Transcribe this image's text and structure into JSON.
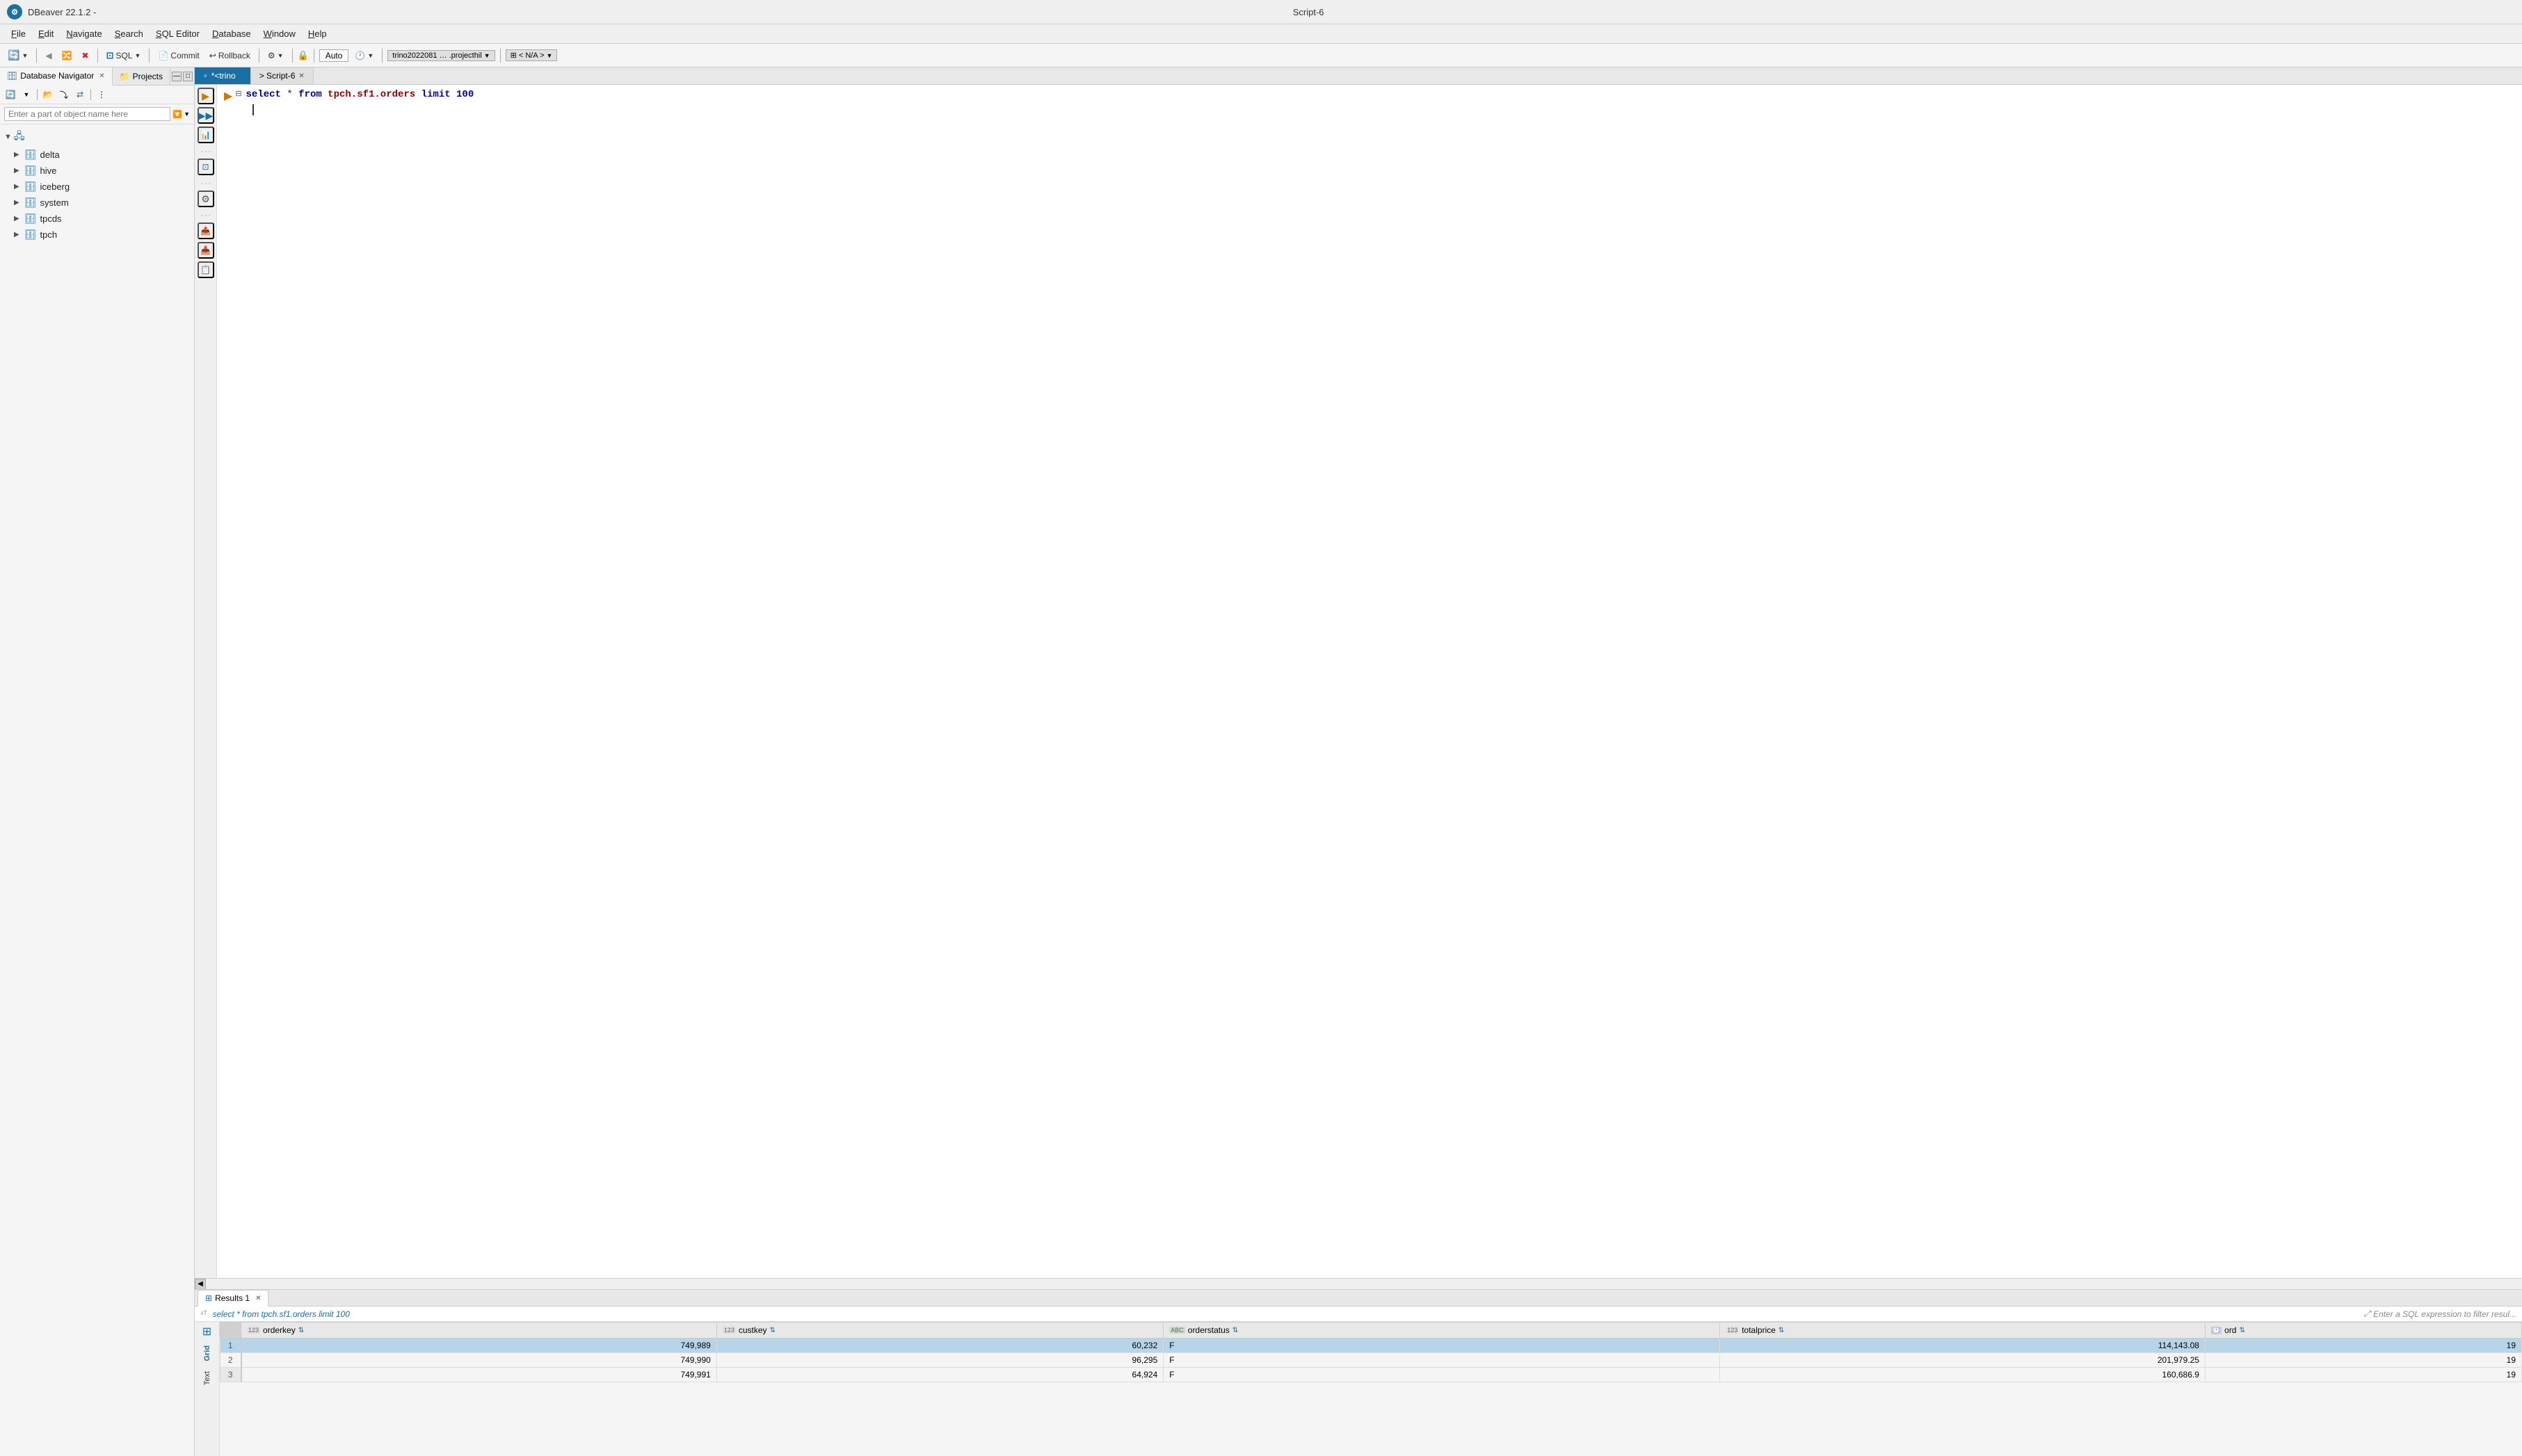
{
  "window": {
    "title": "DBeaver 22.1.2 -",
    "center_title": "Script-6",
    "logo_text": "DB"
  },
  "menu": {
    "items": [
      "File",
      "Edit",
      "Navigate",
      "Search",
      "SQL Editor",
      "Database",
      "Window",
      "Help"
    ]
  },
  "toolbar": {
    "sql_label": "SQL",
    "commit_label": "Commit",
    "rollback_label": "Rollback",
    "auto_label": "Auto",
    "connection_label": "trino2022081 … .projecthil",
    "schema_label": "< N/A >"
  },
  "left_panel": {
    "tab1_label": "Database Navigator",
    "tab2_label": "Projects",
    "search_placeholder": "Enter a part of object name here",
    "tree_items": [
      {
        "label": "delta",
        "type": "db"
      },
      {
        "label": "hive",
        "type": "db"
      },
      {
        "label": "iceberg",
        "type": "db"
      },
      {
        "label": "system",
        "type": "db"
      },
      {
        "label": "tpcds",
        "type": "db"
      },
      {
        "label": "tpch",
        "type": "db"
      }
    ]
  },
  "editor": {
    "tab1_label": "*<trino",
    "tab2_label": "> Script-6",
    "query": "select * from tpch.sf1.orders limit 100"
  },
  "results": {
    "tab_label": "Results 1",
    "filter_query": "select * from tpch.sf1.orders limit 100",
    "filter_placeholder": "Enter a SQL expression to filter resul...",
    "columns": [
      {
        "type": "123",
        "label": "orderkey",
        "type_label": "123"
      },
      {
        "type": "123",
        "label": "custkey",
        "type_label": "123"
      },
      {
        "type": "ABC",
        "label": "orderstatus",
        "type_label": "abc"
      },
      {
        "type": "123",
        "label": "totalprice",
        "type_label": "123"
      },
      {
        "type": "clock",
        "label": "ord",
        "type_label": "🕐"
      }
    ],
    "rows": [
      {
        "num": "1",
        "orderkey": "749,989",
        "custkey": "60,232",
        "orderstatus": "F",
        "totalprice": "114,143.08",
        "ord": "19",
        "selected": true
      },
      {
        "num": "2",
        "orderkey": "749,990",
        "custkey": "96,295",
        "orderstatus": "F",
        "totalprice": "201,979.25",
        "ord": "19",
        "selected": false
      },
      {
        "num": "3",
        "orderkey": "749,991",
        "custkey": "64,924",
        "orderstatus": "F",
        "totalprice": "160,686.9",
        "ord": "19",
        "selected": false
      }
    ]
  }
}
